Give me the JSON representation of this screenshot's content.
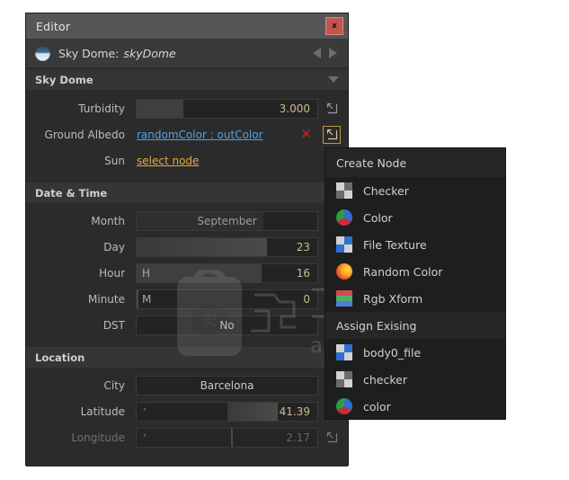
{
  "window": {
    "title": "Editor",
    "close_label": "x",
    "node_type": "Sky Dome:",
    "node_name": "skyDome",
    "dome_icon": "sky-dome-icon",
    "prev_icon": "triangle-left-icon",
    "next_icon": "triangle-right-icon"
  },
  "sections": {
    "sky_dome": {
      "title": "Sky Dome",
      "rows": {
        "turbidity": {
          "label": "Turbidity",
          "value": "3.000",
          "fill_pct": 26
        },
        "ground_albedo": {
          "label": "Ground Albedo",
          "link": "randomColor : outColor",
          "clear": "✕"
        },
        "sun": {
          "label": "Sun",
          "link": "select node"
        }
      }
    },
    "date_time": {
      "title": "Date & Time",
      "rows": {
        "month": {
          "label": "Month",
          "value": "September",
          "fill_pct": 70
        },
        "day": {
          "label": "Day",
          "value": "23",
          "fill_pct": 72
        },
        "hour": {
          "label": "Hour",
          "prefix": "H",
          "value": "16",
          "fill_pct": 69
        },
        "minute": {
          "label": "Minute",
          "prefix": "M",
          "value": "0",
          "fill_pct": 1
        },
        "dst": {
          "label": "DST",
          "value": "No"
        }
      }
    },
    "location": {
      "title": "Location",
      "rows": {
        "city": {
          "label": "City",
          "value": "Barcelona"
        },
        "latitude": {
          "label": "Latitude",
          "prefix": "°",
          "value": "41.39",
          "fill_pct": 69
        },
        "longitude": {
          "label": "Longitude",
          "prefix": "°",
          "value": "2.17",
          "fill_pct": 52
        }
      }
    }
  },
  "menu": {
    "create_title": "Create Node",
    "assign_title": "Assign Exising",
    "create_items": [
      {
        "label": "Checker",
        "icon": "checker-icon"
      },
      {
        "label": "Color",
        "icon": "color-pie-icon"
      },
      {
        "label": "File Texture",
        "icon": "file-texture-icon"
      },
      {
        "label": "Random Color",
        "icon": "random-color-icon"
      },
      {
        "label": "Rgb Xform",
        "icon": "rgb-xform-icon"
      }
    ],
    "assign_items": [
      {
        "label": "body0_file",
        "icon": "file-texture-icon"
      },
      {
        "label": "checker",
        "icon": "checker-icon"
      },
      {
        "label": "color",
        "icon": "color-pie-icon"
      }
    ]
  },
  "watermark": {
    "text": "anxz.com"
  },
  "colors": {
    "accent_blue": "#4ea3e8",
    "accent_gold": "#e8a93a",
    "value_text": "#cdba94",
    "close_red": "#c0564f",
    "focus_gold": "#b79a4a"
  }
}
